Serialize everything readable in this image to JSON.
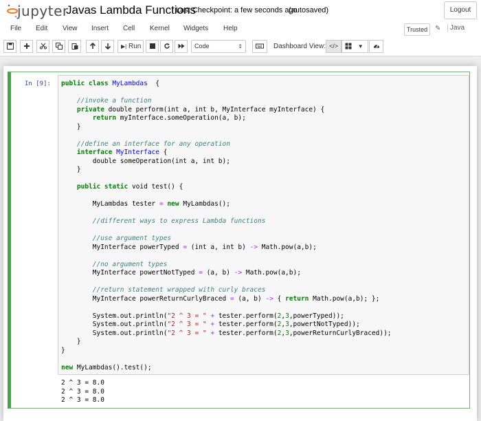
{
  "header": {
    "logo_text": "jupyter",
    "notebook_title": "Javas Lambda Functions",
    "checkpoint": "Last Checkpoint: a few seconds ago",
    "autosave": "(autosaved)",
    "logout_label": "Logout"
  },
  "menu": {
    "items": [
      "File",
      "Edit",
      "View",
      "Insert",
      "Cell",
      "Kernel",
      "Widgets",
      "Help"
    ],
    "trusted_label": "Trusted",
    "kernel_name": "Java"
  },
  "toolbar": {
    "run_label": "Run",
    "cell_type": "Code",
    "dashboard_label": "Dashboard View:"
  },
  "cell": {
    "prompt": "In [9]:",
    "code_lines": [
      [
        [
          "kw",
          "public class "
        ],
        [
          "cls",
          "MyLambdas"
        ],
        [
          "",
          "  {"
        ]
      ],
      [],
      [
        [
          "cm",
          "    //invoke a function"
        ]
      ],
      [
        [
          "kw",
          "    private "
        ],
        [
          "",
          "double perform(int a, int b, MyInterface myInterface) {"
        ]
      ],
      [
        [
          "kw",
          "        return "
        ],
        [
          "",
          "myInterface.someOperation(a, b);"
        ]
      ],
      [
        [
          "",
          "    }"
        ]
      ],
      [],
      [
        [
          "cm",
          "    //define an interface for any operation"
        ]
      ],
      [
        [
          "kw",
          "    interface "
        ],
        [
          "cls",
          "MyInterface"
        ],
        [
          "",
          " {"
        ]
      ],
      [
        [
          "",
          "        double someOperation(int a, int b);"
        ]
      ],
      [
        [
          "",
          "    }"
        ]
      ],
      [],
      [
        [
          "kw",
          "    public static "
        ],
        [
          "",
          "void test() {"
        ]
      ],
      [],
      [
        [
          "",
          "        MyLambdas tester "
        ],
        [
          "op",
          "="
        ],
        [
          "kw",
          " new "
        ],
        [
          "",
          "MyLambdas();"
        ]
      ],
      [],
      [
        [
          "cm",
          "        //different ways to express Lambda functions"
        ]
      ],
      [],
      [
        [
          "cm",
          "        //use argument types"
        ]
      ],
      [
        [
          "",
          "        MyInterface powerTyped "
        ],
        [
          "op",
          "="
        ],
        [
          "",
          " (int a, int b) "
        ],
        [
          "op",
          "->"
        ],
        [
          "",
          " Math.pow(a,b);"
        ]
      ],
      [],
      [
        [
          "cm",
          "        //no argument types"
        ]
      ],
      [
        [
          "",
          "        MyInterface powertNotTyped "
        ],
        [
          "op",
          "="
        ],
        [
          "",
          " (a, b) "
        ],
        [
          "op",
          "->"
        ],
        [
          "",
          " Math.pow(a,b);"
        ]
      ],
      [],
      [
        [
          "cm",
          "        //return statement wrapped with curly braces"
        ]
      ],
      [
        [
          "",
          "        MyInterface powerReturnCurlyBraced "
        ],
        [
          "op",
          "="
        ],
        [
          "",
          " (a, b) "
        ],
        [
          "op",
          "->"
        ],
        [
          "",
          " { "
        ],
        [
          "kw",
          "return "
        ],
        [
          "",
          "Math.pow(a,b); };"
        ]
      ],
      [],
      [
        [
          "",
          "        System.out.println("
        ],
        [
          "str",
          "\"2 ^ 3 = \""
        ],
        [
          "op",
          " + "
        ],
        [
          "",
          "tester.perform("
        ],
        [
          "num",
          "2"
        ],
        [
          "",
          ","
        ],
        [
          "num",
          "3"
        ],
        [
          "",
          ",powerTyped));"
        ]
      ],
      [
        [
          "",
          "        System.out.println("
        ],
        [
          "str",
          "\"2 ^ 3 = \""
        ],
        [
          "op",
          " + "
        ],
        [
          "",
          "tester.perform("
        ],
        [
          "num",
          "2"
        ],
        [
          "",
          ","
        ],
        [
          "num",
          "3"
        ],
        [
          "",
          ",powertNotTyped));"
        ]
      ],
      [
        [
          "",
          "        System.out.println("
        ],
        [
          "str",
          "\"2 ^ 3 = \""
        ],
        [
          "op",
          " + "
        ],
        [
          "",
          "tester.perform("
        ],
        [
          "num",
          "2"
        ],
        [
          "",
          ","
        ],
        [
          "num",
          "3"
        ],
        [
          "",
          ",powerReturnCurlyBraced));"
        ]
      ],
      [
        [
          "",
          "    }"
        ]
      ],
      [
        [
          "",
          "}"
        ]
      ],
      [],
      [
        [
          "kw",
          "new "
        ],
        [
          "",
          "MyLambdas().test();"
        ]
      ]
    ],
    "output_lines": [
      "2 ^ 3 = 8.0",
      "2 ^ 3 = 8.0",
      "2 ^ 3 = 8.0"
    ]
  }
}
